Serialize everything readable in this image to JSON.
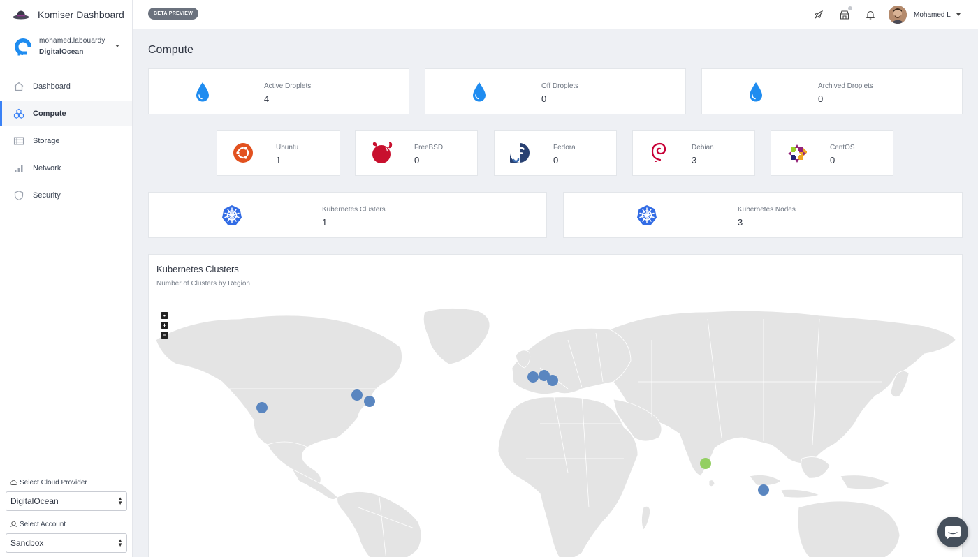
{
  "app": {
    "title": "Komiser Dashboard",
    "beta_badge": "BETA PREVIEW"
  },
  "account": {
    "name": "mohamed.labouardy",
    "provider": "DigitalOcean"
  },
  "sidebar": {
    "items": [
      {
        "label": "Dashboard",
        "icon": "home-icon",
        "active": false
      },
      {
        "label": "Compute",
        "icon": "compute-icon",
        "active": true
      },
      {
        "label": "Storage",
        "icon": "storage-icon",
        "active": false
      },
      {
        "label": "Network",
        "icon": "network-icon",
        "active": false
      },
      {
        "label": "Security",
        "icon": "shield-icon",
        "active": false
      }
    ],
    "cloud_provider_label": "Select Cloud Provider",
    "cloud_provider_value": "DigitalOcean",
    "account_label": "Select Account",
    "account_value": "Sandbox"
  },
  "topbar": {
    "user_name": "Mohamed L"
  },
  "page": {
    "title": "Compute"
  },
  "droplets": [
    {
      "label": "Active Droplets",
      "value": "4"
    },
    {
      "label": "Off Droplets",
      "value": "0"
    },
    {
      "label": "Archived Droplets",
      "value": "0"
    }
  ],
  "distros": [
    {
      "label": "Ubuntu",
      "value": "1",
      "icon": "ubuntu-icon"
    },
    {
      "label": "FreeBSD",
      "value": "0",
      "icon": "freebsd-icon"
    },
    {
      "label": "Fedora",
      "value": "0",
      "icon": "fedora-icon"
    },
    {
      "label": "Debian",
      "value": "3",
      "icon": "debian-icon"
    },
    {
      "label": "CentOS",
      "value": "0",
      "icon": "centos-icon"
    }
  ],
  "kubernetes": [
    {
      "label": "Kubernetes Clusters",
      "value": "1"
    },
    {
      "label": "Kubernetes Nodes",
      "value": "3"
    }
  ],
  "map_panel": {
    "title": "Kubernetes Clusters",
    "subtitle": "Number of Clusters by Region",
    "zoom": {
      "reset": "•",
      "in": "+",
      "out": "−"
    },
    "colors": {
      "land": "#e4e4e4",
      "borders": "#ffffff",
      "region": "#5a86c0",
      "highlight": "#93cf62"
    }
  },
  "colors": {
    "accent": "#3b82f6",
    "droplet": "#1f8cf0",
    "kubernetes": "#326ce5"
  }
}
